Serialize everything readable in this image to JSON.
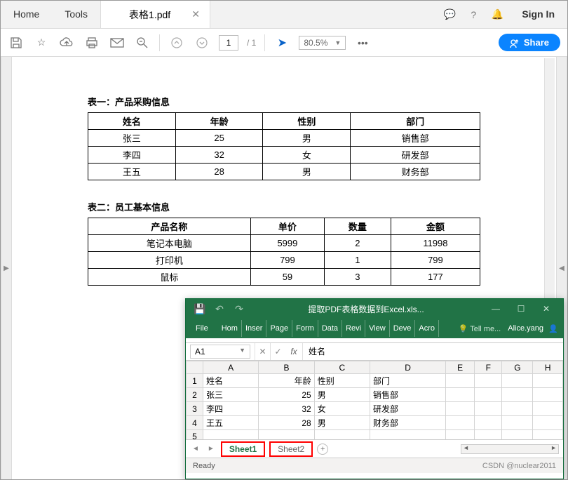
{
  "acrobat": {
    "nav": {
      "home": "Home",
      "tools": "Tools"
    },
    "doc_tab": "表格1.pdf",
    "signin": "Sign In",
    "page_current": "1",
    "page_total": "/ 1",
    "zoom": "80.5%",
    "share": "Share"
  },
  "pdf": {
    "table1_title": "表一：产品采购信息",
    "table1_headers": [
      "姓名",
      "年龄",
      "性别",
      "部门"
    ],
    "table1_rows": [
      [
        "张三",
        "25",
        "男",
        "销售部"
      ],
      [
        "李四",
        "32",
        "女",
        "研发部"
      ],
      [
        "王五",
        "28",
        "男",
        "财务部"
      ]
    ],
    "table2_title": "表二：员工基本信息",
    "table2_headers": [
      "产品名称",
      "单价",
      "数量",
      "金额"
    ],
    "table2_rows": [
      [
        "笔记本电脑",
        "5999",
        "2",
        "11998"
      ],
      [
        "打印机",
        "799",
        "1",
        "799"
      ],
      [
        "鼠标",
        "59",
        "3",
        "177"
      ]
    ]
  },
  "excel": {
    "title": "提取PDF表格数据到Excel.xls...",
    "ribbon": {
      "file": "File",
      "tabs": [
        "Hom",
        "Inser",
        "Page",
        "Form",
        "Data",
        "Revi",
        "View",
        "Deve",
        "Acro"
      ],
      "tell": "Tell me...",
      "user": "Alice.yang"
    },
    "namebox": "A1",
    "fx_value": "姓名",
    "col_headers": [
      "A",
      "B",
      "C",
      "D",
      "E",
      "F",
      "G",
      "H"
    ],
    "rows": [
      {
        "n": "1",
        "cells": [
          "姓名",
          "年龄",
          "性别",
          "部门",
          "",
          "",
          "",
          ""
        ]
      },
      {
        "n": "2",
        "cells": [
          "张三",
          "25",
          "男",
          "销售部",
          "",
          "",
          "",
          ""
        ]
      },
      {
        "n": "3",
        "cells": [
          "李四",
          "32",
          "女",
          "研发部",
          "",
          "",
          "",
          ""
        ]
      },
      {
        "n": "4",
        "cells": [
          "王五",
          "28",
          "男",
          "财务部",
          "",
          "",
          "",
          ""
        ]
      },
      {
        "n": "5",
        "cells": [
          "",
          "",
          "",
          "",
          "",
          "",
          "",
          ""
        ]
      }
    ],
    "numeric_cols": [
      1
    ],
    "sheets": {
      "s1": "Sheet1",
      "s2": "Sheet2"
    },
    "status": "Ready",
    "watermark": "CSDN @nuclear2011"
  }
}
